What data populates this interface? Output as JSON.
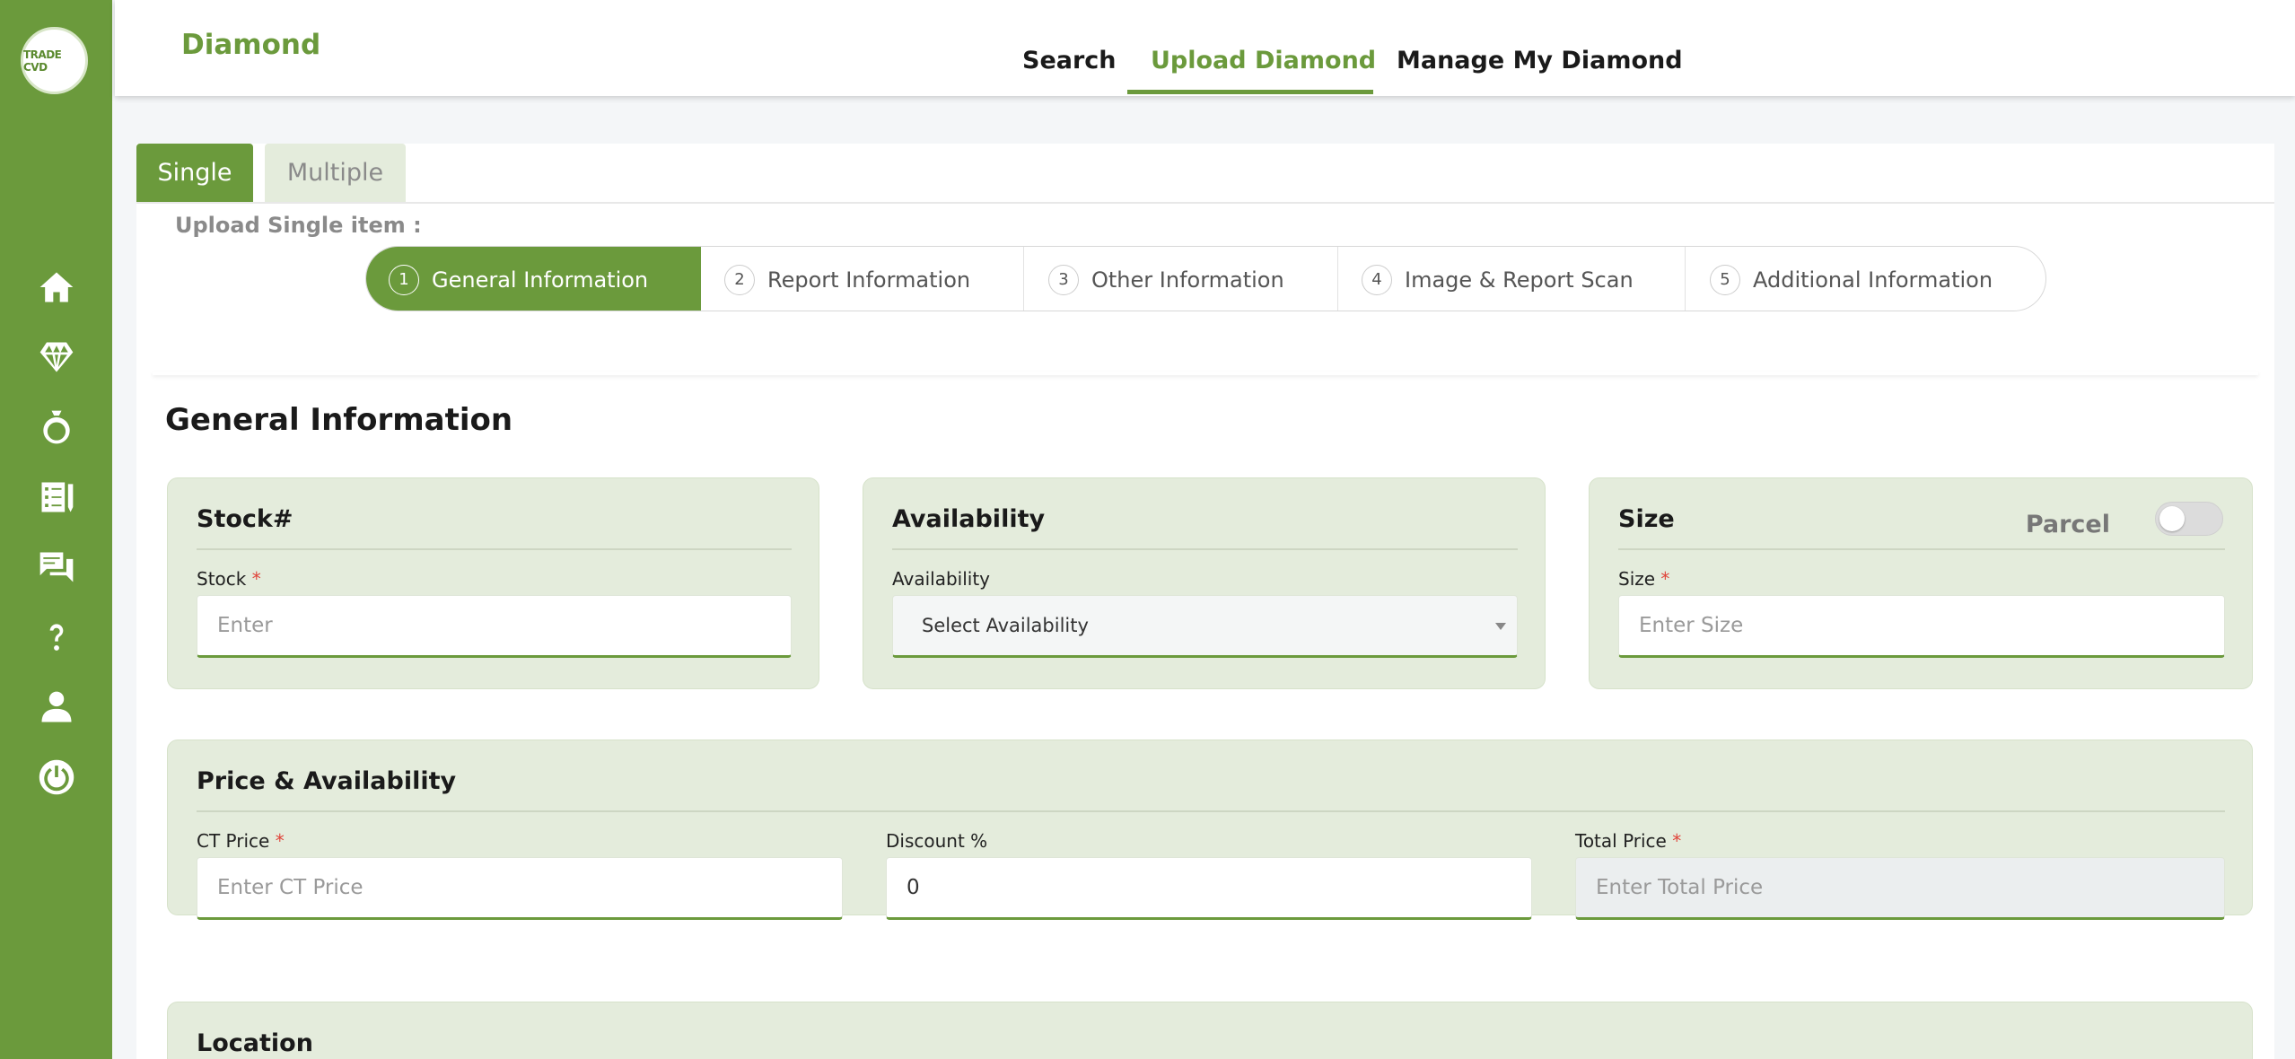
{
  "sidebar": {
    "logo_text": "TRADE CVD",
    "icons": [
      "home-icon",
      "diamond-icon",
      "ring-icon",
      "checklist-icon",
      "chat-icon",
      "help-icon",
      "user-icon",
      "power-icon"
    ],
    "accent": "#6b9a3c"
  },
  "header": {
    "brand": "Diamond",
    "nav": [
      "Search",
      "Upload Diamond",
      "Manage My Diamond"
    ],
    "active_nav": "Upload Diamond"
  },
  "tabs": {
    "single": "Single",
    "multiple": "Multiple",
    "active": "Single"
  },
  "upload_label": "Upload Single item :",
  "steps": [
    {
      "num": "1",
      "label": "General Information"
    },
    {
      "num": "2",
      "label": "Report Information"
    },
    {
      "num": "3",
      "label": "Other Information"
    },
    {
      "num": "4",
      "label": "Image & Report Scan"
    },
    {
      "num": "5",
      "label": "Additional Information"
    }
  ],
  "section_title": "General Information",
  "stock_panel": {
    "title": "Stock#",
    "label": "Stock",
    "required": "*",
    "placeholder": "Enter",
    "value": ""
  },
  "availability_panel": {
    "title": "Availability",
    "label": "Availability",
    "selected": "Select Availability"
  },
  "size_panel": {
    "title": "Size",
    "parcel_label": "Parcel",
    "parcel_on": false,
    "label": "Size",
    "required": "*",
    "placeholder": "Enter Size",
    "value": ""
  },
  "price_panel": {
    "title": "Price & Availability",
    "ct_label": "CT Price",
    "ct_required": "*",
    "ct_placeholder": "Enter CT Price",
    "discount_label": "Discount %",
    "discount_value": "0",
    "total_label": "Total Price",
    "total_required": "*",
    "total_placeholder": "Enter Total Price"
  },
  "location_panel": {
    "title": "Location"
  }
}
